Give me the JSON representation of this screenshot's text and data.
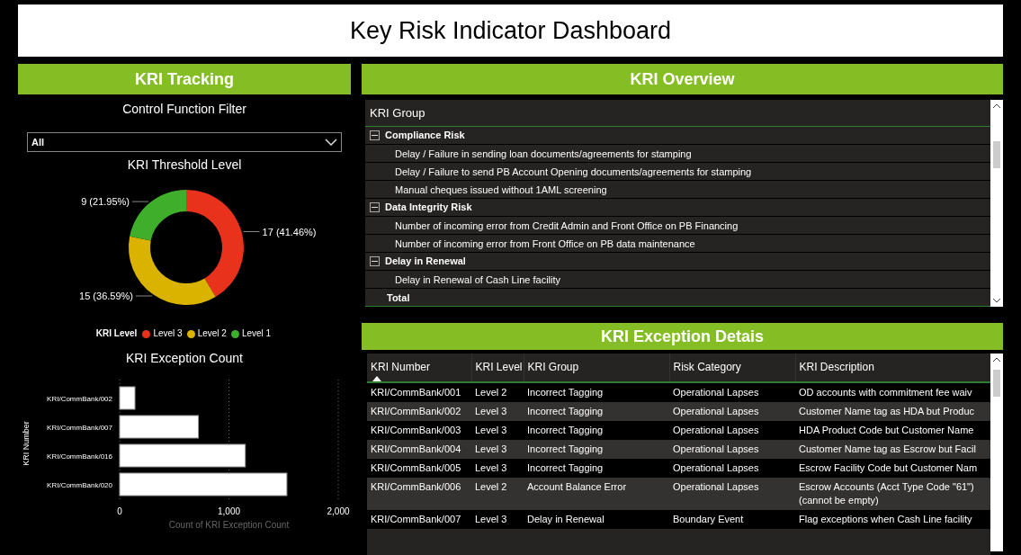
{
  "title": "Key Risk Indicator Dashboard",
  "tracking": {
    "header": "KRI Tracking",
    "filter": {
      "label": "Control Function Filter",
      "value": "All"
    },
    "threshold": {
      "title": "KRI Threshold Level",
      "legend_title": "KRI Level",
      "chart_data": {
        "type": "donut",
        "categories": [
          "Level 3",
          "Level 2",
          "Level 1"
        ],
        "values": [
          17,
          15,
          9
        ],
        "colors": [
          "#e8321c",
          "#d9b300",
          "#3fae2a"
        ],
        "value_labels": [
          "17 (41.46%)",
          "15 (36.59%)",
          "9 (21.95%)"
        ]
      }
    },
    "exceptions": {
      "title": "KRI Exception Count",
      "chart_data": {
        "type": "bar",
        "orientation": "horizontal",
        "ylabel": "KRI Number",
        "xlabel": "Count of KRI Exception Count",
        "categories": [
          "KRI/CommBank/002",
          "KRI/CommBank/007",
          "KRI/CommBank/016",
          "KRI/CommBank/020"
        ],
        "values": [
          140,
          720,
          1150,
          1530
        ],
        "xlim": [
          0,
          2000
        ],
        "xticks": [
          {
            "value": 0,
            "label": "0"
          },
          {
            "value": 1000,
            "label": "1,000"
          },
          {
            "value": 2000,
            "label": "2,000"
          }
        ]
      }
    }
  },
  "overview": {
    "header": "KRI Overview",
    "column": "KRI Group",
    "total": "Total",
    "groups": [
      {
        "label": "Compliance Risk",
        "expanded": true,
        "children": [
          {
            "label": "Delay / Failure in sending loan documents/agreements for stamping"
          },
          {
            "label": "Delay / Failure to send PB Account Opening documents/agreements for stamping"
          },
          {
            "label": "Manual cheques issued without 1AML screening"
          }
        ]
      },
      {
        "label": "Data Integrity Risk",
        "expanded": true,
        "children": [
          {
            "label": "Number of incoming error from Credit Admin and Front Office on PB Financing"
          },
          {
            "label": "Number of incoming error from Front Office on PB data maintenance"
          }
        ]
      },
      {
        "label": "Delay in Renewal",
        "expanded": true,
        "children": [
          {
            "label": "Delay in Renewal of Cash Line facility"
          }
        ]
      }
    ]
  },
  "details": {
    "header": "KRI Exception Detais",
    "columns": [
      {
        "label": "KRI Number",
        "sorted": true
      },
      {
        "label": "KRI Level",
        "sorted": false
      },
      {
        "label": "KRI Group",
        "sorted": false
      },
      {
        "label": "Risk Category",
        "sorted": false
      },
      {
        "label": "KRI Description",
        "sorted": false
      }
    ],
    "rows": [
      [
        "KRI/CommBank/001",
        "Level 2",
        "Incorrect Tagging",
        "Operational Lapses",
        "OD accounts with commitment fee waiv"
      ],
      [
        "KRI/CommBank/002",
        "Level 3",
        "Incorrect Tagging",
        "Operational Lapses",
        "Customer Name tag as HDA but Produc"
      ],
      [
        "KRI/CommBank/003",
        "Level 3",
        "Incorrect Tagging",
        "Operational Lapses",
        "HDA Product Code but Customer Name"
      ],
      [
        "KRI/CommBank/004",
        "Level 3",
        "Incorrect Tagging",
        "Operational Lapses",
        "Customer Name tag as Escrow but Facil"
      ],
      [
        "KRI/CommBank/005",
        "Level 3",
        "Incorrect Tagging",
        "Operational Lapses",
        "Escrow Facility Code but Customer Nam"
      ],
      [
        "KRI/CommBank/006",
        "Level 2",
        "Account Balance Error",
        "Operational Lapses",
        "Escrow Accounts (Acct Type Code \"61\")\n(cannot be empty)"
      ],
      [
        "KRI/CommBank/007",
        "Level 3",
        "Delay in Renewal",
        "Boundary Event",
        "Flag exceptions when Cash Line facility"
      ]
    ]
  }
}
